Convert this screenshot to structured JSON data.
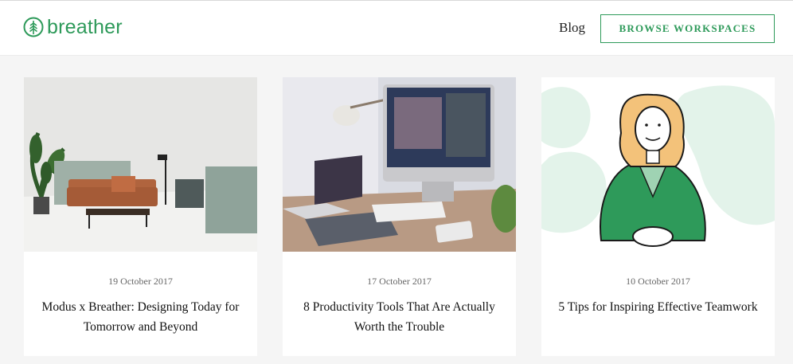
{
  "header": {
    "logo_text": "breather",
    "logo_icon": "tree-icon",
    "nav_blog": "Blog",
    "browse_button": "BROWSE WORKSPACES"
  },
  "colors": {
    "brand_green": "#2e9a5a",
    "background": "#f5f5f5"
  },
  "cards": [
    {
      "date": "19 October 2017",
      "title": "Modus x Breather: Designing Today for Tomorrow and Beyond",
      "image": "lounge-furniture-image"
    },
    {
      "date": "17 October 2017",
      "title": "8 Productivity Tools That Are Actually Worth the Trouble",
      "image": "desk-workspace-image"
    },
    {
      "date": "10 October 2017",
      "title": "5 Tips for Inspiring Effective Teamwork",
      "image": "businesswoman-illustration"
    }
  ]
}
